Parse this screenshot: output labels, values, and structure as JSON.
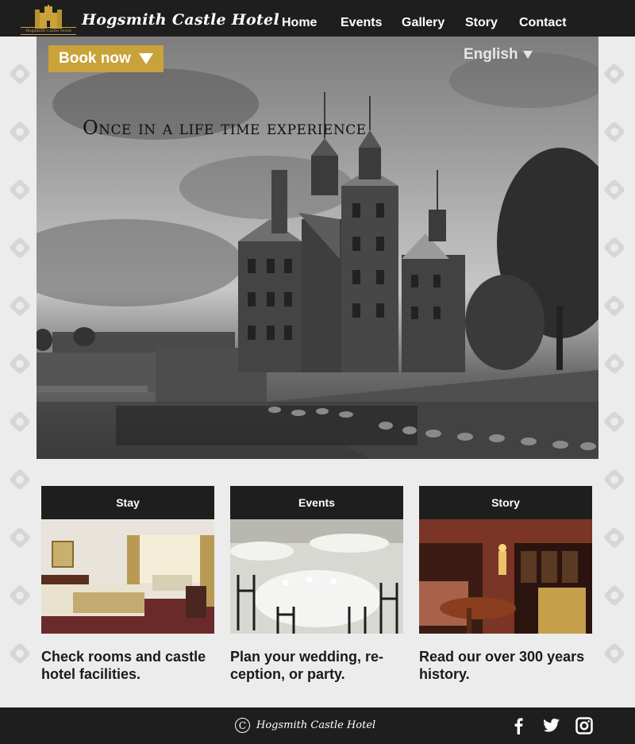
{
  "header": {
    "brand": "Hogsmith Castle Hotel",
    "logo_banner": "Hogsmith Castle Hotel",
    "nav": [
      {
        "label": "Home"
      },
      {
        "label": "Events"
      },
      {
        "label": "Gallery"
      },
      {
        "label": "Story"
      },
      {
        "label": "Contact"
      }
    ]
  },
  "hero": {
    "book_label": "Book now",
    "language": "English",
    "tagline": "Once in a life time experience"
  },
  "cards": [
    {
      "title": "Stay",
      "text": "Check rooms and castle hotel facilities."
    },
    {
      "title": "Events",
      "text": "Plan your wedding, re- ception, or party."
    },
    {
      "title": "Story",
      "text": "Read our over 300 years history."
    }
  ],
  "footer": {
    "copyright_symbol": "C",
    "brand": "Hogsmith Castle Hotel",
    "social": [
      "facebook-icon",
      "twitter-icon",
      "instagram-icon"
    ]
  },
  "colors": {
    "accent": "#c9a23a",
    "dark": "#1e1e1e",
    "background": "#ececec"
  }
}
